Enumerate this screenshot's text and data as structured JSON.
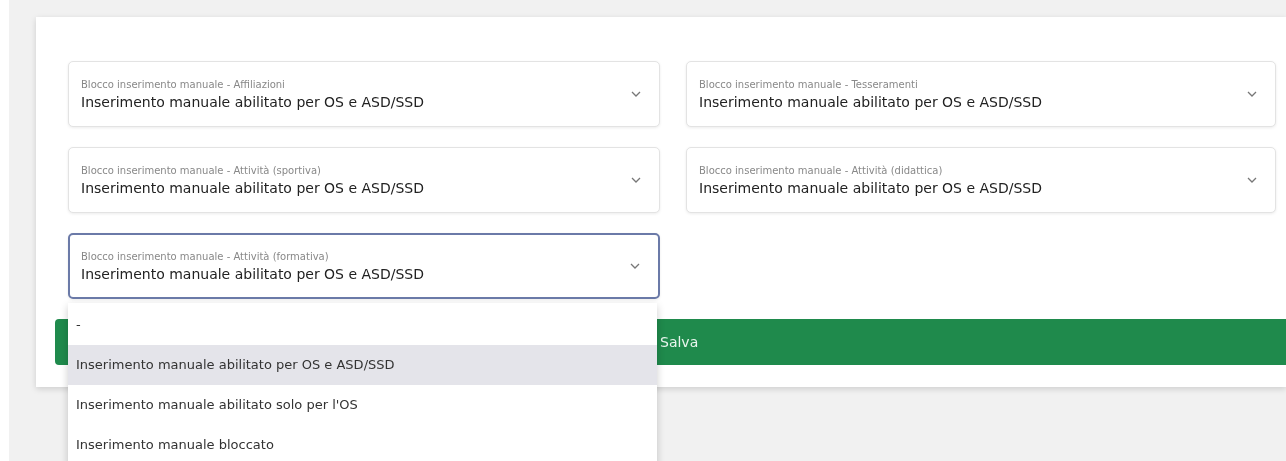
{
  "fields": [
    {
      "label": "Blocco inserimento manuale - Affiliazioni",
      "value": "Inserimento manuale abilitato per OS e ASD/SSD",
      "focused": false
    },
    {
      "label": "Blocco inserimento manuale - Tesseramenti",
      "value": "Inserimento manuale abilitato per OS e ASD/SSD",
      "focused": false
    },
    {
      "label": "Blocco inserimento manuale - Attività (sportiva)",
      "value": "Inserimento manuale abilitato per OS e ASD/SSD",
      "focused": false
    },
    {
      "label": "Blocco inserimento manuale - Attività (didattica)",
      "value": "Inserimento manuale abilitato per OS e ASD/SSD",
      "focused": false
    },
    {
      "label": "Blocco inserimento manuale - Attività (formativa)",
      "value": "Inserimento manuale abilitato per OS e ASD/SSD",
      "focused": true
    }
  ],
  "dropdown": {
    "options": [
      {
        "label": "-",
        "selected": false
      },
      {
        "label": "Inserimento manuale abilitato per OS e ASD/SSD",
        "selected": true
      },
      {
        "label": "Inserimento manuale abilitato solo per l'OS",
        "selected": false
      },
      {
        "label": "Inserimento manuale bloccato",
        "selected": false
      }
    ]
  },
  "save_button": "Salva"
}
